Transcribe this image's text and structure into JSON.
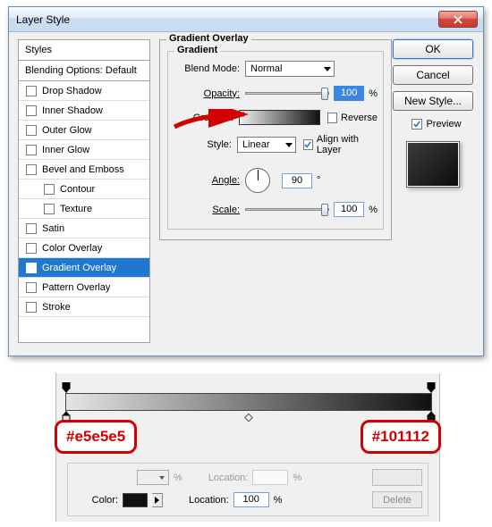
{
  "dialog": {
    "title": "Layer Style",
    "styles_header": "Styles",
    "blend_header": "Blending Options: Default",
    "style_items": [
      {
        "label": "Drop Shadow",
        "indent": false,
        "checked": false
      },
      {
        "label": "Inner Shadow",
        "indent": false,
        "checked": false
      },
      {
        "label": "Outer Glow",
        "indent": false,
        "checked": false
      },
      {
        "label": "Inner Glow",
        "indent": false,
        "checked": false
      },
      {
        "label": "Bevel and Emboss",
        "indent": false,
        "checked": false
      },
      {
        "label": "Contour",
        "indent": true,
        "checked": false
      },
      {
        "label": "Texture",
        "indent": true,
        "checked": false
      },
      {
        "label": "Satin",
        "indent": false,
        "checked": false
      },
      {
        "label": "Color Overlay",
        "indent": false,
        "checked": false
      },
      {
        "label": "Gradient Overlay",
        "indent": false,
        "checked": true,
        "selected": true
      },
      {
        "label": "Pattern Overlay",
        "indent": false,
        "checked": false
      },
      {
        "label": "Stroke",
        "indent": false,
        "checked": false
      }
    ],
    "group_title": "Gradient Overlay",
    "subgroup_title": "Gradient",
    "labels": {
      "blend_mode": "Blend Mode:",
      "opacity": "Opacity:",
      "gradient": "Gradient:",
      "style": "Style:",
      "angle": "Angle:",
      "scale": "Scale:",
      "reverse": "Reverse",
      "align": "Align with Layer",
      "pct": "%",
      "deg": "°"
    },
    "values": {
      "blend_mode": "Normal",
      "opacity": "100",
      "style": "Linear",
      "angle": "90",
      "scale": "100",
      "reverse": false,
      "align": true
    },
    "buttons": {
      "ok": "OK",
      "cancel": "Cancel",
      "new_style": "New Style...",
      "preview_label": "Preview",
      "preview_checked": true
    }
  },
  "gradient_editor": {
    "left_color": "#e5e5e5",
    "right_color": "#101112",
    "opacity_row_label": "",
    "location_label": "Location:",
    "color_label": "Color:",
    "pct": "%",
    "location_value": "100",
    "delete_label": "Delete"
  }
}
